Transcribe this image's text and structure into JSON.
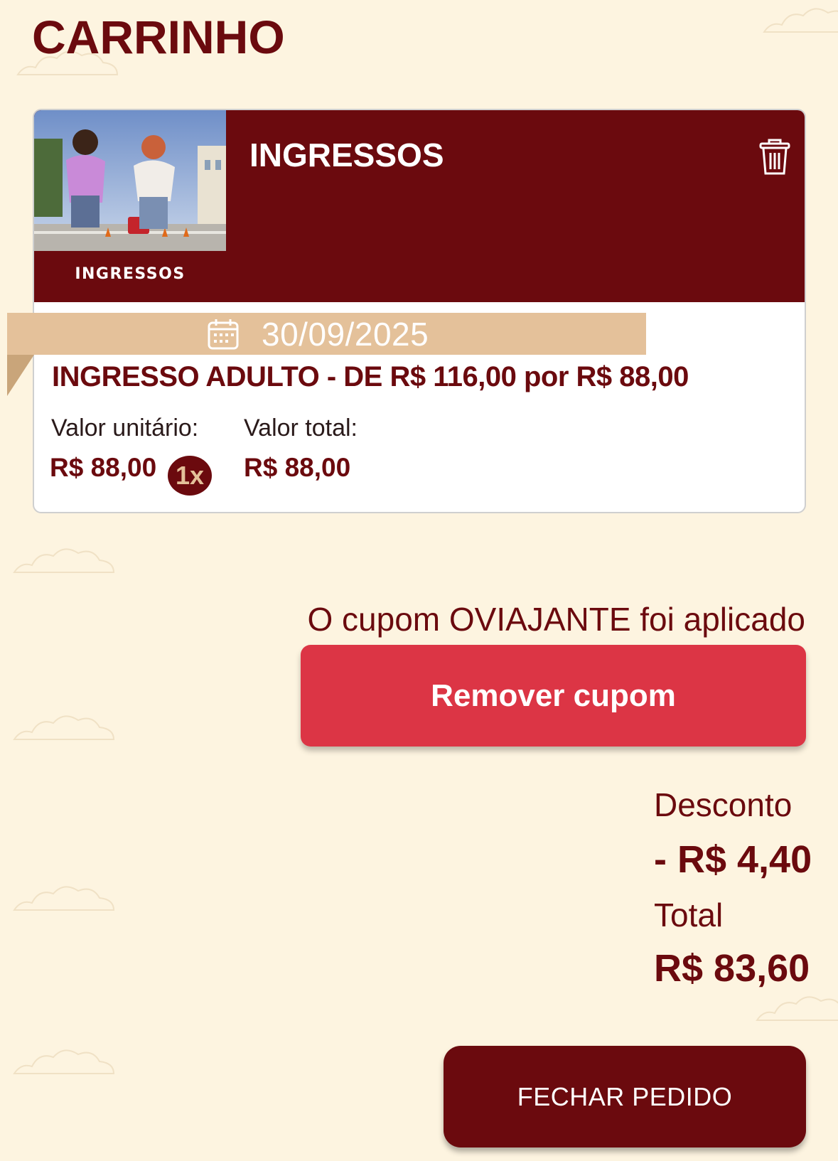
{
  "page": {
    "title": "CARRINHO"
  },
  "cart_item": {
    "thumbnail_label": "INGRESSOS",
    "title": "INGRESSOS",
    "date": "30/09/2025",
    "product_name": "INGRESSO ADULTO - DE R$ 116,00 por R$ 88,00",
    "unit_price_label": "Valor unitário:",
    "unit_price": "R$ 88,00",
    "quantity": "1x",
    "total_price_label": "Valor total:",
    "total_price": "R$ 88,00"
  },
  "coupon": {
    "message": "O cupom OVIAJANTE foi aplicado",
    "remove_label": "Remover cupom"
  },
  "summary": {
    "discount_label": "Desconto",
    "discount_value": "- R$ 4,40",
    "total_label": "Total",
    "total_value": "R$ 83,60"
  },
  "actions": {
    "checkout_label": "FECHAR PEDIDO"
  },
  "colors": {
    "background": "#fdf4e0",
    "brand": "#6b0a0e",
    "accent_red": "#dc3545",
    "ribbon": "#e4c19a"
  },
  "icons": {
    "delete": "trash-icon",
    "date": "calendar-icon",
    "decoration": "cloud-icon"
  }
}
